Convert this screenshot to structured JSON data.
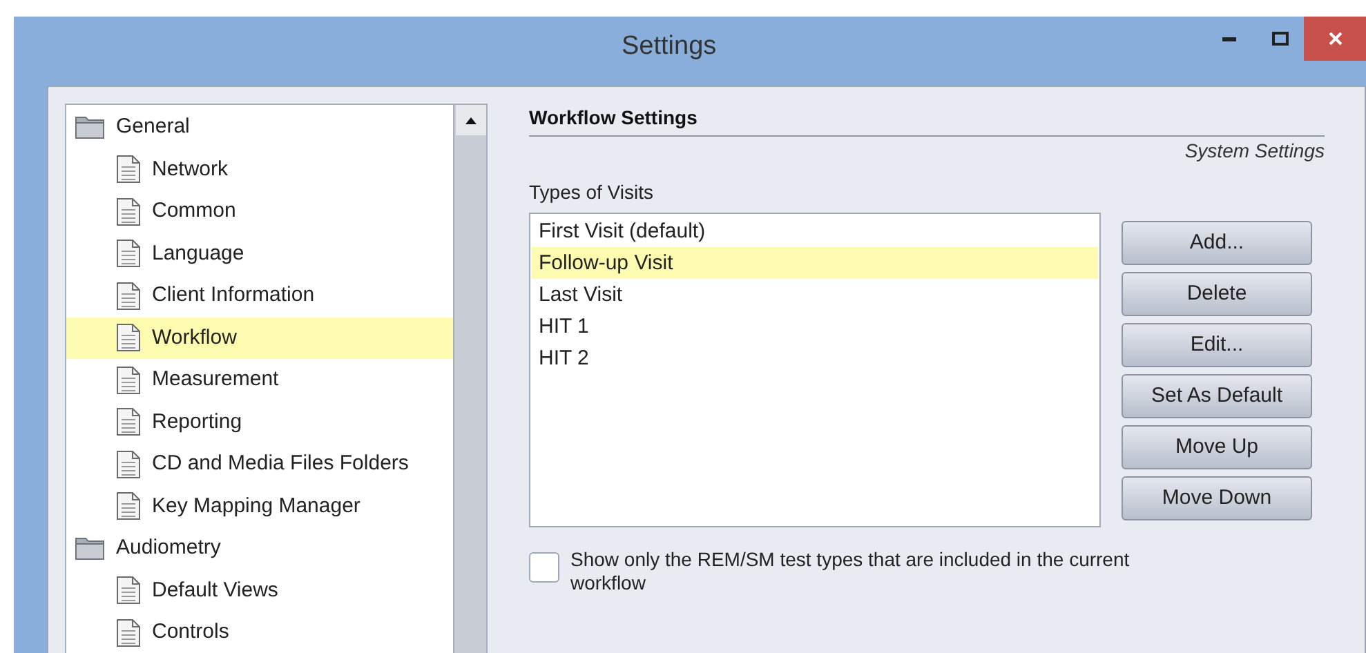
{
  "window": {
    "title": "Settings"
  },
  "tree": [
    {
      "label": "General",
      "kind": "folder",
      "selected": false,
      "children": [
        {
          "label": "Network",
          "kind": "page",
          "selected": false
        },
        {
          "label": "Common",
          "kind": "page",
          "selected": false
        },
        {
          "label": "Language",
          "kind": "page",
          "selected": false
        },
        {
          "label": "Client Information",
          "kind": "page",
          "selected": false
        },
        {
          "label": "Workflow",
          "kind": "page",
          "selected": true
        },
        {
          "label": "Measurement",
          "kind": "page",
          "selected": false
        },
        {
          "label": "Reporting",
          "kind": "page",
          "selected": false
        },
        {
          "label": "CD and Media Files Folders",
          "kind": "page",
          "selected": false
        },
        {
          "label": "Key Mapping Manager",
          "kind": "page",
          "selected": false
        }
      ]
    },
    {
      "label": "Audiometry",
      "kind": "folder",
      "selected": false,
      "children": [
        {
          "label": "Default Views",
          "kind": "page",
          "selected": false
        },
        {
          "label": "Controls",
          "kind": "page",
          "selected": false
        }
      ]
    }
  ],
  "panel": {
    "title": "Workflow Settings",
    "subtitle": "System Settings",
    "list_label": "Types of Visits",
    "visits": [
      {
        "label": "First Visit (default)",
        "selected": false
      },
      {
        "label": "Follow-up Visit",
        "selected": true
      },
      {
        "label": "Last Visit",
        "selected": false
      },
      {
        "label": "HIT 1",
        "selected": false
      },
      {
        "label": "HIT 2",
        "selected": false
      }
    ],
    "buttons": [
      "Add...",
      "Delete",
      "Edit...",
      "Set As Default",
      "Move Up",
      "Move Down"
    ],
    "option": {
      "label": "Show only the REM/SM test types that are included in the current workflow",
      "checked": false
    }
  }
}
